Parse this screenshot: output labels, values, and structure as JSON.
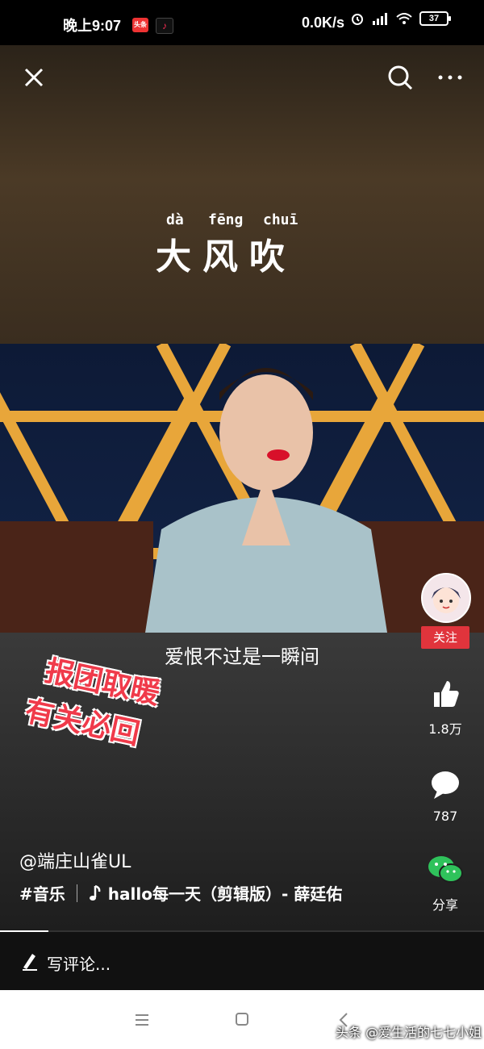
{
  "status": {
    "time": "晚上9:07",
    "app1": "头条",
    "app2": "♪",
    "net_speed": "0.0K/s",
    "battery": "37"
  },
  "video": {
    "pinyin": [
      "dà",
      "fēng",
      "chuī"
    ],
    "title": "大风吹",
    "lyric": "爱恨不过是一瞬间",
    "sticker_line1": "报团取暖",
    "sticker_line2": "有关必回"
  },
  "topbar": {
    "close_icon": "close-icon",
    "search_icon": "search-icon",
    "more_icon": "more-icon"
  },
  "side": {
    "follow_label": "关注",
    "like_count": "1.8万",
    "comment_count": "787",
    "share_label": "分享"
  },
  "post": {
    "author": "@端庄山雀UL",
    "tag": "#音乐",
    "music": "hallo每一天（剪辑版）- 薛廷佑"
  },
  "comment": {
    "placeholder": "写评论..."
  },
  "progress": 0.1,
  "watermark": "头条 @爱生活的七七小姐",
  "colors": {
    "follow": "#e0343c",
    "wechat": "#2fc25b",
    "sticker": "#f03a4a"
  }
}
